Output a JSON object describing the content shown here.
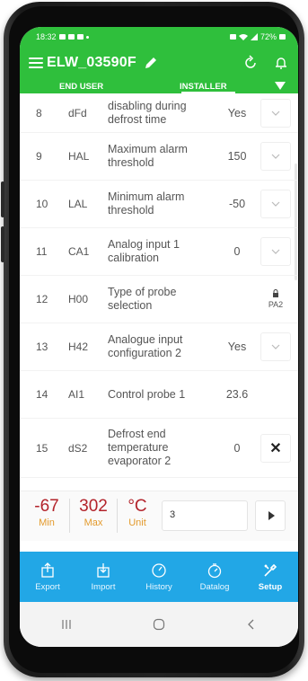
{
  "status_bar": {
    "time": "18:32",
    "battery": "72%"
  },
  "app_bar": {
    "title": "ELW_03590F"
  },
  "tabs": {
    "end_user": "END USER",
    "installer": "INSTALLER"
  },
  "rows": [
    {
      "num": "8",
      "code": "dFd",
      "desc": "disabling during defrost time",
      "value": "Yes",
      "action": "dropdown"
    },
    {
      "num": "9",
      "code": "HAL",
      "desc": "Maximum alarm threshold",
      "value": "150",
      "action": "dropdown"
    },
    {
      "num": "10",
      "code": "LAL",
      "desc": "Minimum alarm threshold",
      "value": "-50",
      "action": "dropdown"
    },
    {
      "num": "11",
      "code": "CA1",
      "desc": "Analog input 1 calibration",
      "value": "0",
      "action": "dropdown"
    },
    {
      "num": "12",
      "code": "H00",
      "desc": "Type of probe selection",
      "value": "",
      "action": "lock",
      "lock_label": "PA2"
    },
    {
      "num": "13",
      "code": "H42",
      "desc": "Analogue input configuration 2",
      "value": "Yes",
      "action": "dropdown"
    },
    {
      "num": "14",
      "code": "AI1",
      "desc": "Control probe 1",
      "value": "23.6",
      "action": "none"
    },
    {
      "num": "15",
      "code": "dS2",
      "desc": "Defrost end temperature evaporator 2",
      "value": "0",
      "action": "close"
    }
  ],
  "summary": {
    "min_value": "-67",
    "min_label": "Min",
    "max_value": "302",
    "max_label": "Max",
    "unit_value": "°C",
    "unit_label": "Unit",
    "input_value": "3"
  },
  "bottom_nav": {
    "export": "Export",
    "import": "Import",
    "history": "History",
    "datalog": "Datalog",
    "setup": "Setup"
  },
  "colors": {
    "brand_green": "#2fbf3c",
    "nav_blue": "#22a7e6",
    "value_red": "#b3232b",
    "label_orange": "#e39a2c"
  }
}
